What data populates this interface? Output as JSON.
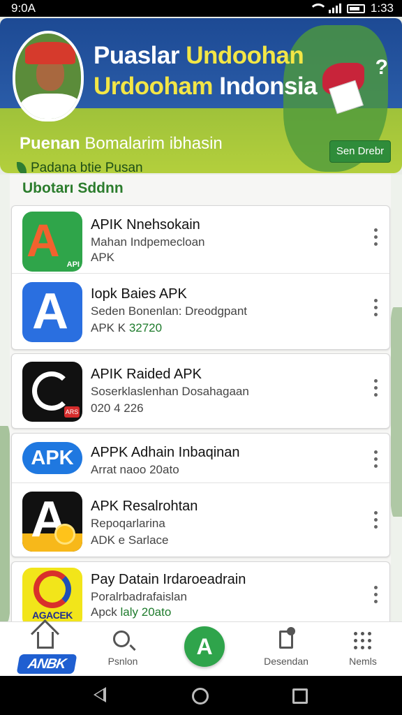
{
  "status_bar": {
    "time": "9:0A",
    "clock": "1:33"
  },
  "banner": {
    "title_white": "Puaslar ",
    "title_yellow_1": "Undoohan",
    "title_line2_yellow": "Urdooham",
    "title_line2_white": " Indonsia",
    "subtitle_bold": "Puenan",
    "subtitle_rest": " Bomalarim ibhasin",
    "tagline": "Padana btie Pusan",
    "button_label": "Sen Drebr",
    "menu_glyph": "?"
  },
  "section": {
    "title": "Ubotarı Sddnn"
  },
  "apps": [
    {
      "title": "APIK Nnehsokain",
      "subtitle": "Mahan Indpemecloan",
      "meta": "APK",
      "meta_green": "",
      "icon": "green-a-icon",
      "icon_text": "API"
    },
    {
      "title": "Iopk Baies APK",
      "subtitle": "Seden Bonenlan: Dreodgpant",
      "meta": "APK K ",
      "meta_green": "32720",
      "icon": "blue-a-icon",
      "icon_text": ""
    },
    {
      "title": "APIK Raided APK",
      "subtitle": "Soserklaslenhan Dosahagaan",
      "meta": "020 4 226",
      "meta_green": "",
      "icon": "black-swirl-icon",
      "icon_text": "ARS"
    },
    {
      "title": "APPK Adhain Inbaqinan",
      "subtitle": "Arrat naoo 20ato",
      "meta": "",
      "meta_green": "",
      "icon": "apk-pill-icon",
      "icon_text": "APK"
    },
    {
      "title": "APK Resalrohtan",
      "subtitle": "Repoqarlarina",
      "meta": "ADK e Sarlace",
      "meta_green": "",
      "icon": "yellow-a-icon",
      "icon_text": ""
    },
    {
      "title": "Pay Datain Irdaroeadrain",
      "subtitle": "Poralrbadrafaislan",
      "meta": "Apck ",
      "meta_green": "laly 20ato",
      "icon": "agacuk-logo-icon",
      "icon_text": "AGACEK"
    }
  ],
  "bottom_nav": {
    "brand": "ANBK",
    "items": [
      {
        "label": "",
        "icon": "home-icon"
      },
      {
        "label": "Psnlon",
        "icon": "search-icon"
      },
      {
        "label": "",
        "icon": "apk-center-icon",
        "glyph": "A"
      },
      {
        "label": "Desendan",
        "icon": "document-icon"
      },
      {
        "label": "Nemls",
        "icon": "grid-icon"
      }
    ]
  }
}
